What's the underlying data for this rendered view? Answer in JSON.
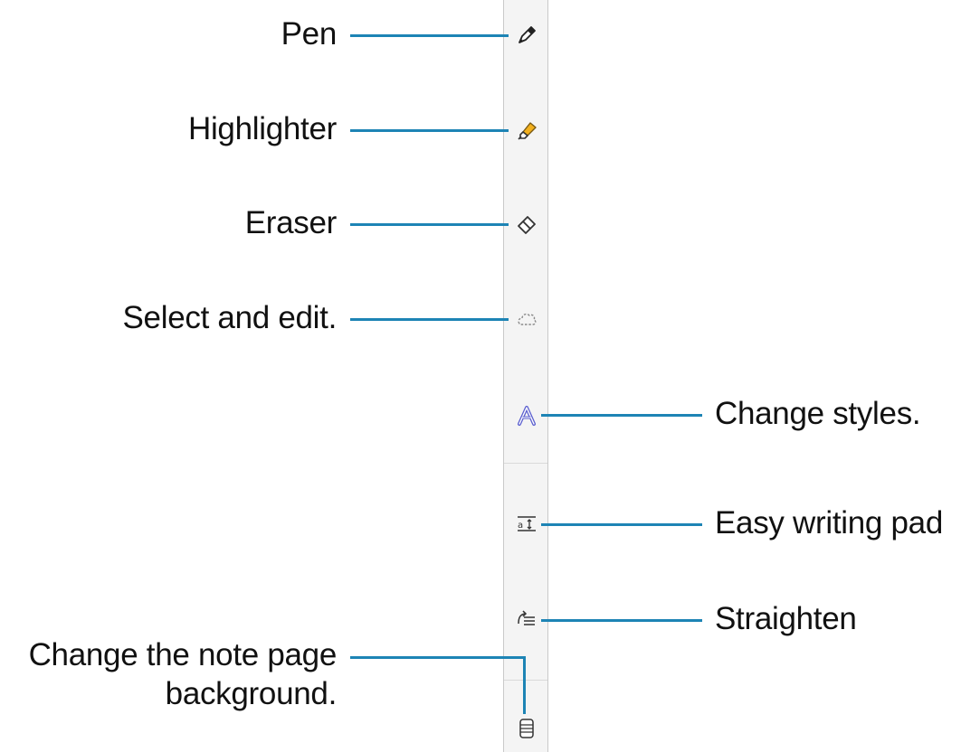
{
  "colors": {
    "leader_line": "#1d84b5",
    "toolbar_bg": "#f4f4f4",
    "highlighter_fill": "#f2b01e",
    "styles_icon": "#5b5fcf"
  },
  "tools": [
    {
      "id": "pen",
      "icon": "pen-icon",
      "label": "Pen"
    },
    {
      "id": "highlighter",
      "icon": "highlighter-icon",
      "label": "Highlighter"
    },
    {
      "id": "eraser",
      "icon": "eraser-icon",
      "label": "Eraser"
    },
    {
      "id": "select",
      "icon": "lasso-icon",
      "label": "Select and edit."
    },
    {
      "id": "styles",
      "icon": "text-style-icon",
      "label": "Change styles."
    },
    {
      "id": "writing_pad",
      "icon": "writing-pad-icon",
      "label": "Easy writing pad"
    },
    {
      "id": "straighten",
      "icon": "straighten-icon",
      "label": "Straighten"
    },
    {
      "id": "background",
      "icon": "page-background-icon",
      "label_line1": "Change the note page",
      "label_line2": "background."
    }
  ]
}
